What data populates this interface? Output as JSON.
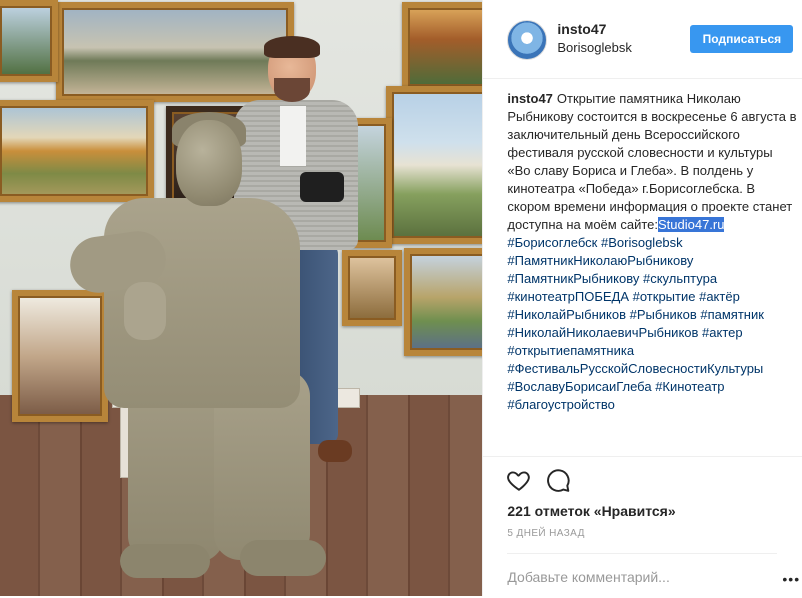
{
  "header": {
    "username": "insto47",
    "location": "Borisoglebsk",
    "follow_label": "Подписаться"
  },
  "caption": {
    "username": "insto47",
    "text": "Открытие памятника Николаю Рыбникову состоится в воскресенье 6 августа в заключительный день Всероссийского фестиваля русской словесности и культуры «Во славу Бориса и Глеба». В полдень у кинотеатра «Победа» г.Борисоглебска. В скором времени информация о проекте станет доступна на моём сайте:",
    "link": "Studio47.ru",
    "hashtags": [
      "#Борисоглебск",
      "#Borisoglebsk",
      "#ПамятникНиколаюРыбникову",
      "#ПамятникРыбникову",
      "#скульптура",
      "#кинотеатрПОБЕДА",
      "#открытие",
      "#актёр",
      "#НиколайРыбников",
      "#Рыбников",
      "#памятник",
      "#НиколайНиколаевичРыбников",
      "#актер",
      "#открытиепамятника",
      "#ФестивальРусскойСловесностиКультуры",
      "#ВославуБорисаиГлеба",
      "#Кинотеатр",
      "#благоустройство"
    ]
  },
  "actions": {
    "like_icon": "heart-icon",
    "comment_icon": "comment-icon",
    "likes": "221 отметок «Нравится»",
    "time": "5 ДНЕЙ НАЗАД"
  },
  "comment": {
    "placeholder": "Добавьте комментарий...",
    "more_icon": "more-options-icon"
  },
  "colors": {
    "follow_button": "#3897f0",
    "hashtag": "#003569",
    "selection": "#3875d7"
  }
}
